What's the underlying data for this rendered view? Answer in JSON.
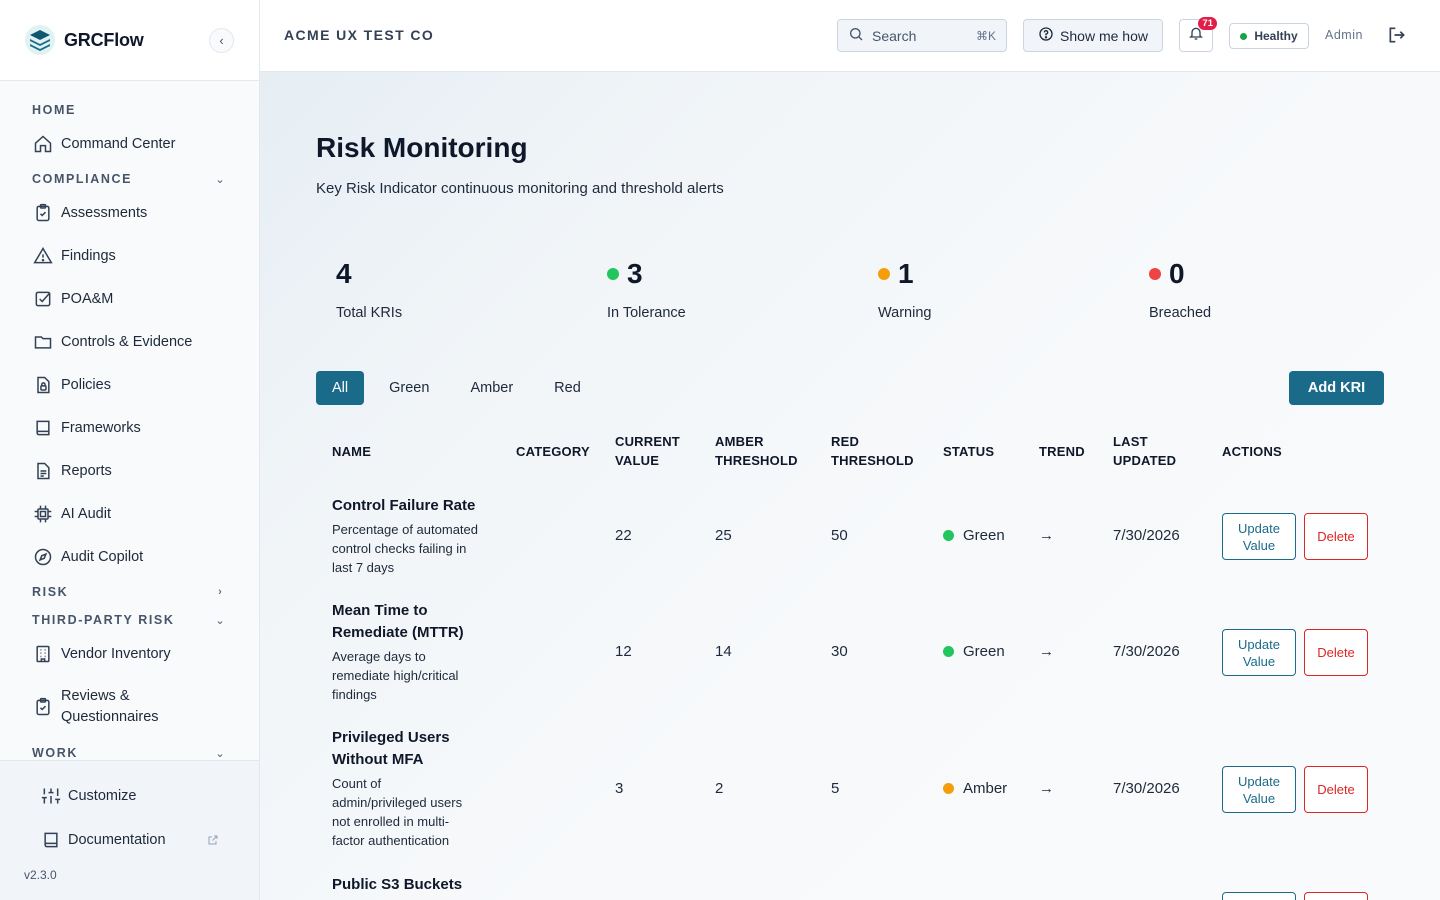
{
  "brand": {
    "name": "GRCFlow"
  },
  "sidebar": {
    "home_section": "HOME",
    "compliance_section": "COMPLIANCE",
    "risk_section": "RISK",
    "tpr_section": "THIRD-PARTY RISK",
    "work_section": "WORK",
    "items": {
      "command_center": "Command Center",
      "assessments": "Assessments",
      "findings": "Findings",
      "poam": "POA&M",
      "controls": "Controls & Evidence",
      "policies": "Policies",
      "frameworks": "Frameworks",
      "reports": "Reports",
      "ai_audit": "AI Audit",
      "audit_copilot": "Audit Copilot",
      "vendor_inventory": "Vendor Inventory",
      "reviews_line1": "Reviews &",
      "reviews_line2": "Questionnaires"
    },
    "footer": {
      "customize": "Customize",
      "documentation": "Documentation",
      "version": "v2.3.0"
    }
  },
  "topbar": {
    "org_name": "ACME UX TEST CO",
    "search_placeholder": "Search",
    "search_shortcut": "⌘K",
    "show_me_how": "Show me how",
    "notification_count": "71",
    "health_status": "Healthy",
    "user_role": "Admin"
  },
  "page": {
    "title": "Risk Monitoring",
    "subtitle": "Key Risk Indicator continuous monitoring and threshold alerts"
  },
  "stats": {
    "total": {
      "value": "4",
      "label": "Total KRIs"
    },
    "in_tolerance": {
      "value": "3",
      "label": "In Tolerance",
      "color": "#22c55e"
    },
    "warning": {
      "value": "1",
      "label": "Warning",
      "color": "#f59e0b"
    },
    "breached": {
      "value": "0",
      "label": "Breached",
      "color": "#ef4444"
    }
  },
  "filters": {
    "all": "All",
    "green": "Green",
    "amber": "Amber",
    "red": "Red"
  },
  "add_button": "Add KRI",
  "table": {
    "headers": {
      "name": "NAME",
      "category": "CATEGORY",
      "current_1": "CURRENT",
      "current_2": "VALUE",
      "amber_1": "AMBER",
      "amber_2": "THRESHOLD",
      "red_1": "RED",
      "red_2": "THRESHOLD",
      "status": "STATUS",
      "trend": "TREND",
      "updated_1": "LAST",
      "updated_2": "UPDATED",
      "actions": "ACTIONS"
    },
    "update_label_1": "Update",
    "update_label_2": "Value",
    "delete_label": "Delete",
    "rows": [
      {
        "name_1": "Control Failure Rate",
        "desc_1": "Percentage of automated",
        "desc_2": "control checks failing in",
        "desc_3": "last 7 days",
        "current": "22",
        "amber": "25",
        "red": "50",
        "status": "Green",
        "trend": "→",
        "updated": "7/30/2026"
      },
      {
        "name_1": "Mean Time to",
        "name_2": "Remediate (MTTR)",
        "desc_1": "Average days to",
        "desc_2": "remediate high/critical",
        "desc_3": "findings",
        "current": "12",
        "amber": "14",
        "red": "30",
        "status": "Green",
        "trend": "→",
        "updated": "7/30/2026"
      },
      {
        "name_1": "Privileged Users",
        "name_2": "Without MFA",
        "desc_1": "Count of",
        "desc_2": "admin/privileged users",
        "desc_3": "not enrolled in multi-",
        "desc_4": "factor authentication",
        "current": "3",
        "amber": "2",
        "red": "5",
        "status": "Amber",
        "trend": "→",
        "updated": "7/30/2026"
      },
      {
        "name_1": "Public S3 Buckets"
      }
    ]
  },
  "colors": {
    "accent": "#1a6b8a",
    "green": "#22c55e",
    "amber": "#f59e0b",
    "red": "#ef4444",
    "delete": "#dc2626"
  }
}
